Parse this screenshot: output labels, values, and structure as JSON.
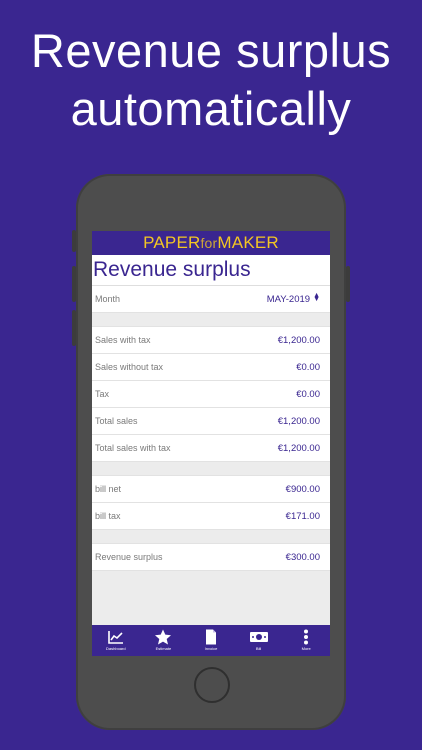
{
  "headline": {
    "line1": "Revenue surplus",
    "line2": "automatically"
  },
  "app": {
    "brand_part1": "PAPER",
    "brand_part2": "for",
    "brand_part3": "MAKER",
    "page_title": "Revenue surplus",
    "brand_color": "#3a2690",
    "accent_color": "#f3c623"
  },
  "month": {
    "label": "Month",
    "value": "MAY-2019"
  },
  "sales_rows": [
    {
      "label": "Sales with tax",
      "value": "€1,200.00"
    },
    {
      "label": "Sales without tax",
      "value": "€0.00"
    },
    {
      "label": "Tax",
      "value": "€0.00"
    },
    {
      "label": "Total sales",
      "value": "€1,200.00"
    },
    {
      "label": "Total sales with tax",
      "value": "€1,200.00"
    }
  ],
  "bill_rows": [
    {
      "label": "bill net",
      "value": "€900.00"
    },
    {
      "label": "bill tax",
      "value": "€171.00"
    }
  ],
  "surplus_row": {
    "label": "Revenue surplus",
    "value": "€300.00"
  },
  "tabs": [
    {
      "label": "Dashboard",
      "icon": "chart-icon"
    },
    {
      "label": "Estimate",
      "icon": "star-icon"
    },
    {
      "label": "Invoice",
      "icon": "document-icon"
    },
    {
      "label": "Bill",
      "icon": "banknote-icon"
    },
    {
      "label": "More",
      "icon": "more-icon"
    }
  ]
}
